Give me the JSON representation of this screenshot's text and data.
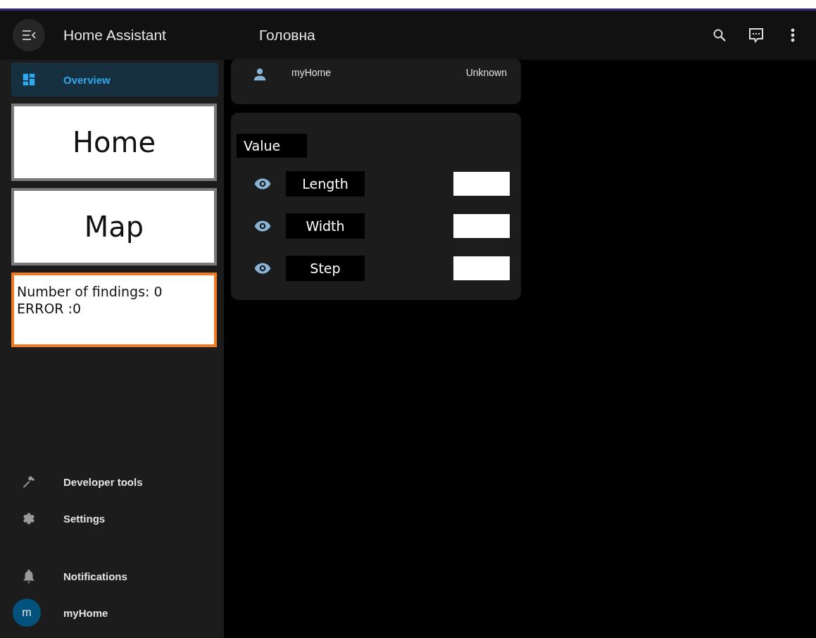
{
  "sidebar": {
    "title": "Home Assistant",
    "items": [
      {
        "label": "Overview",
        "kind": "dashboard",
        "selected": true
      }
    ],
    "buttons": [
      {
        "label": "Home"
      },
      {
        "label": "Map"
      }
    ],
    "status_card": {
      "lines": [
        "Number of findings: 0",
        "ERROR :0"
      ]
    },
    "bottom_items": [
      {
        "label": "Developer tools",
        "kind": "tool",
        "selected": false
      },
      {
        "label": "Settings",
        "kind": "settings",
        "selected": false
      }
    ],
    "notifications": {
      "label": "Notifications"
    },
    "user": {
      "initial": "m",
      "name": "myHome"
    }
  },
  "header": {
    "title": "Головна"
  },
  "person_card": {
    "name": "myHome",
    "state": "Unknown"
  },
  "value_card": {
    "title": "Value",
    "rows": [
      {
        "label": "Length"
      },
      {
        "label": "Width"
      },
      {
        "label": "Step"
      }
    ]
  }
}
